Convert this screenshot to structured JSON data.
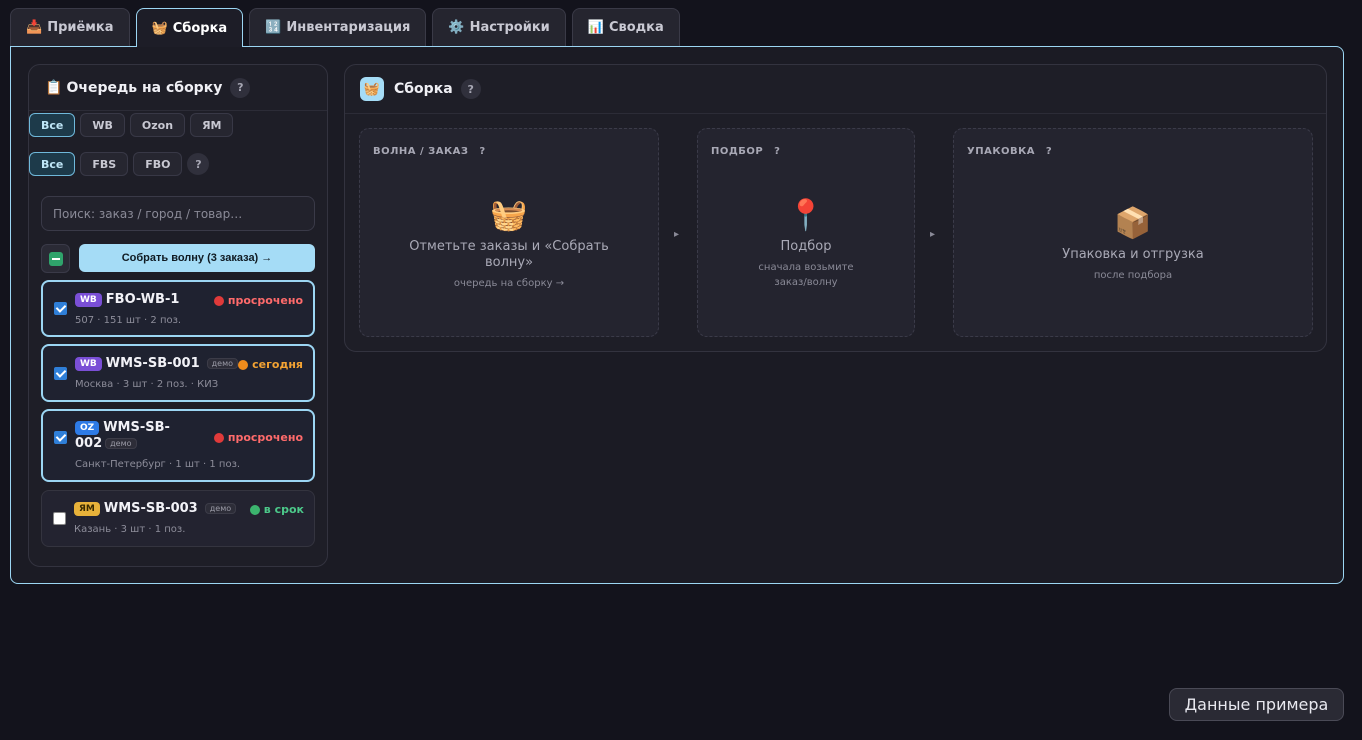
{
  "tabs": [
    {
      "icon": "📥",
      "label": "Приёмка",
      "active": false
    },
    {
      "icon": "🧺",
      "label": "Сборка",
      "active": true
    },
    {
      "icon": "🔢",
      "label": "Инвентаризация",
      "active": false
    },
    {
      "icon": "⚙️",
      "label": "Настройки",
      "active": false
    },
    {
      "icon": "📊",
      "label": "Сводка",
      "active": false
    }
  ],
  "queue": {
    "icon": "📋",
    "title": "Очередь на сборку",
    "help": "?",
    "marketplace_filters": [
      "Все",
      "WB",
      "Ozon",
      "ЯМ"
    ],
    "scheme_filters": [
      "Все",
      "FBS",
      "FBO"
    ],
    "search_placeholder": "Поиск: заказ / город / товар…",
    "wave_button": "Собрать волну (3 заказа) →",
    "orders": [
      {
        "mp": "WB",
        "id": "FBO-WB-1",
        "demo": "",
        "status": "просрочено",
        "meta": "507 · 151 шт · 2 поз.",
        "checked": true
      },
      {
        "mp": "WB",
        "id": "WMS-SB-001",
        "demo": "демо",
        "status": "сегодня",
        "meta": "Москва · 3 шт · 2 поз. · КИЗ",
        "checked": true
      },
      {
        "mp": "OZ",
        "id_line1": "WMS-SB-",
        "id_line2": "002",
        "demo": "демо",
        "status": "просрочено",
        "meta": "Санкт-Петербург · 1 шт · 1 поз.",
        "checked": true
      },
      {
        "mp": "ЯМ",
        "id": "WMS-SB-003",
        "demo": "демо",
        "status": "в срок",
        "meta": "Казань · 3 шт · 1 поз.",
        "checked": false
      }
    ]
  },
  "assembly": {
    "icon": "🧺",
    "title": "Сборка",
    "help": "?",
    "stages": [
      {
        "label": "ВОЛНА / ЗАКАЗ",
        "icon": "🧺",
        "main": "Отметьте заказы и «Собрать волну»",
        "sub": "очередь на сборку →"
      },
      {
        "label": "ПОДБОР",
        "icon": "📍",
        "main": "Подбор",
        "sub": "сначала возьмите заказ/волну"
      },
      {
        "label": "УПАКОВКА",
        "icon": "📦",
        "main": "Упаковка и отгрузка",
        "sub": "после подбора"
      }
    ],
    "arrow": "▸"
  },
  "example_button": "Данные примера"
}
